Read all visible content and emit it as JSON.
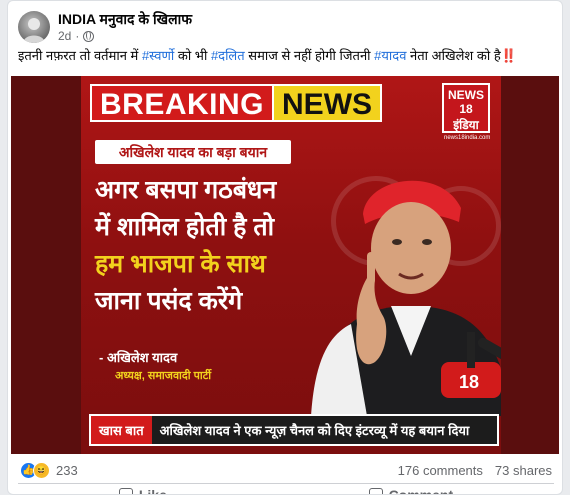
{
  "post": {
    "page_name": "INDIA मनुवाद के खिलाफ",
    "age": "2d",
    "caption_parts": {
      "p1": "इतनी नफ़रत तो वर्तमान में ",
      "tag1": "#स्वर्णो",
      "p2": " को भी ",
      "tag2": "#दलित",
      "p3": " समाज से नहीं होगी जितनी ",
      "tag3": "#यादव",
      "p4": " नेता अखिलेश को है",
      "emoji": "‼️"
    }
  },
  "poster": {
    "breaking": "BREAKING",
    "news": "NEWS",
    "logo_line1": "NEWS 18",
    "logo_line2": "इंडिया",
    "logo_line3": "news18india.com",
    "sub_heading": "अखिलेश यादव का बड़ा बयान",
    "quote_line1": "अगर बसपा गठबंधन",
    "quote_line2": "में शामिल होती है तो",
    "quote_line3": "हम भाजपा के साथ",
    "quote_line4": "जाना पसंद करेंगे",
    "attribution": "- अखिलेश यादव",
    "attribution_role": "अध्यक्ष, समाजवादी पार्टी",
    "ticker_label": "खास बात",
    "ticker_text": "अखिलेश यादव ने एक न्यूज़ चैनल को दिए इंटरव्यू में यह बयान दिया",
    "mic_label": "18"
  },
  "stats": {
    "reactions": "233",
    "comments": "176 comments",
    "shares": "73 shares"
  },
  "actions": {
    "like": "Like",
    "comment": "Comment"
  },
  "colors": {
    "link": "#216fdb",
    "poster_red": "#b01616",
    "poster_yellow": "#f2d21d",
    "like_blue": "#1877f2"
  }
}
